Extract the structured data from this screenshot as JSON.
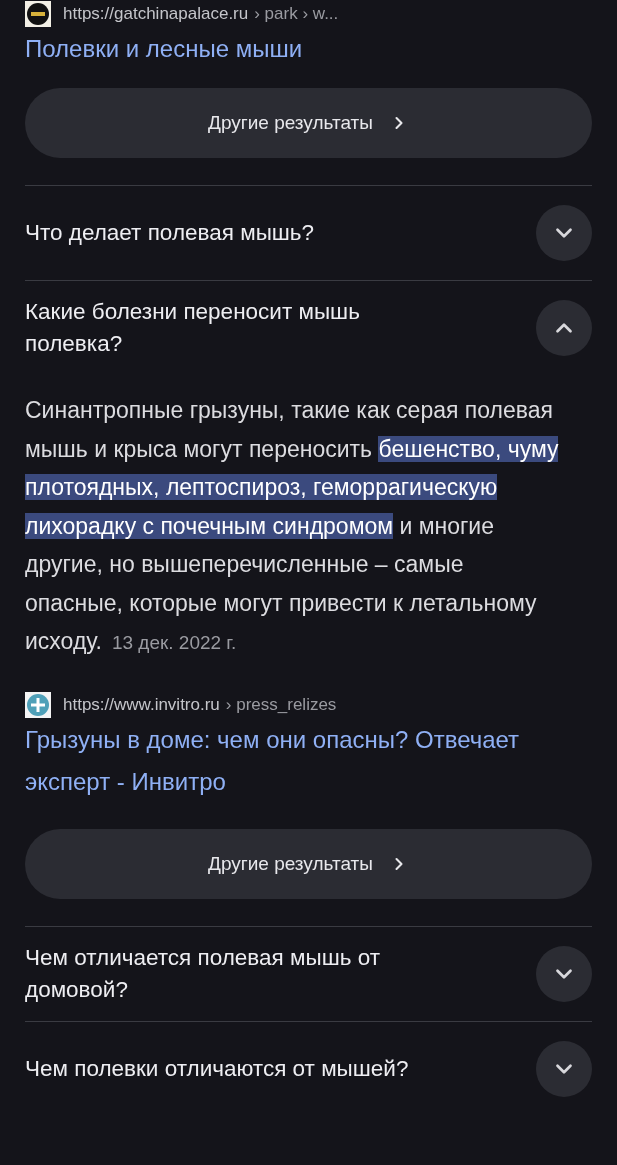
{
  "top_result": {
    "kind": "gatchina",
    "url": "https://gatchinapalace.ru",
    "path": "› park › w...",
    "title": "Полевки и лесные мыши"
  },
  "top_more_button": {
    "label": "Другие результаты"
  },
  "questions": [
    {
      "question": "Что делает полевая мышь?",
      "expanded": false
    },
    {
      "question": "Какие болезни переносит мышь полевка?",
      "expanded": true,
      "answer": {
        "text": "Синантропные грызуны, такие как серая полевая мышь и крыса могут переносить **бешенство, чуму плотоядных, лептоспироз, геморрагическую лихорадку с почечным синдромом** и многие другие, но вышеперечисленные – самые опасные, которые могут привести к летальному исходу.",
        "date": "13 дек. 2022 г."
      },
      "source": {
        "kind": "invitro",
        "url": "https://www.invitro.ru",
        "path": "› press_relizes",
        "title": "Грызуны в доме: чем они опасны? Отвечает эксперт - Инвитро"
      },
      "more_button": {
        "label": "Другие результаты"
      }
    },
    {
      "question": "Чем отличается полевая мышь от домовой?",
      "expanded": false
    },
    {
      "question": "Чем полевки отличаются от мышей?",
      "expanded": false
    }
  ]
}
